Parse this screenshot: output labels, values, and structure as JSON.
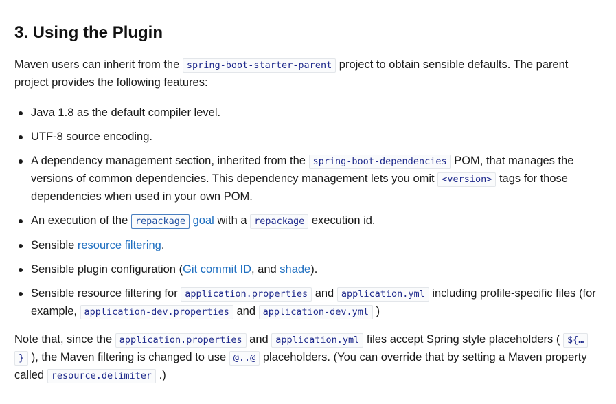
{
  "heading": "3. Using the Plugin",
  "intro": {
    "t1": "Maven users can inherit from the",
    "c1": "spring-boot-starter-parent",
    "t2": "project to obtain sensible defaults. The parent project provides the following features:"
  },
  "features": {
    "f1": "Java 1.8 as the default compiler level.",
    "f2": "UTF-8 source encoding.",
    "f3": {
      "t1": "A dependency management section, inherited from the",
      "c1": "spring-boot-dependencies",
      "t2": "POM, that manages the versions of common dependencies. This dependency management lets you omit",
      "c2": "<version>",
      "t3": "tags for those dependencies when used in your own POM."
    },
    "f4": {
      "t1": "An execution of the",
      "c1": "repackage",
      "link": "goal",
      "t2": "with a",
      "c2": "repackage",
      "t3": "execution id."
    },
    "f5": {
      "t1": "Sensible",
      "link": "resource filtering",
      "t2": "."
    },
    "f6": {
      "t1": "Sensible plugin configuration (",
      "link1": "Git commit ID",
      "t2": ", and",
      "link2": "shade",
      "t3": ")."
    },
    "f7": {
      "t1": "Sensible resource filtering for",
      "c1": "application.properties",
      "t2": "and",
      "c2": "application.yml",
      "t3": "including profile-specific files (for example,",
      "c3": "application-dev.properties",
      "t4": "and",
      "c4": "application-dev.yml",
      "t5": ")"
    }
  },
  "note": {
    "t1": "Note that, since the",
    "c1": "application.properties",
    "t2": "and",
    "c2": "application.yml",
    "t3": "files accept Spring style placeholders (",
    "c3a": "${…",
    "c3b": "}",
    "t4": "), the Maven filtering is changed to use",
    "c4": "@..@",
    "t5": "placeholders. (You can override that by setting a Maven property called",
    "c5": "resource.delimiter",
    "t6": ".)"
  },
  "colors": {
    "link": "#1f6fc0",
    "code_text": "#1f2a8c",
    "code_border": "#e3e6ea",
    "body_text": "#1a1a1a"
  }
}
